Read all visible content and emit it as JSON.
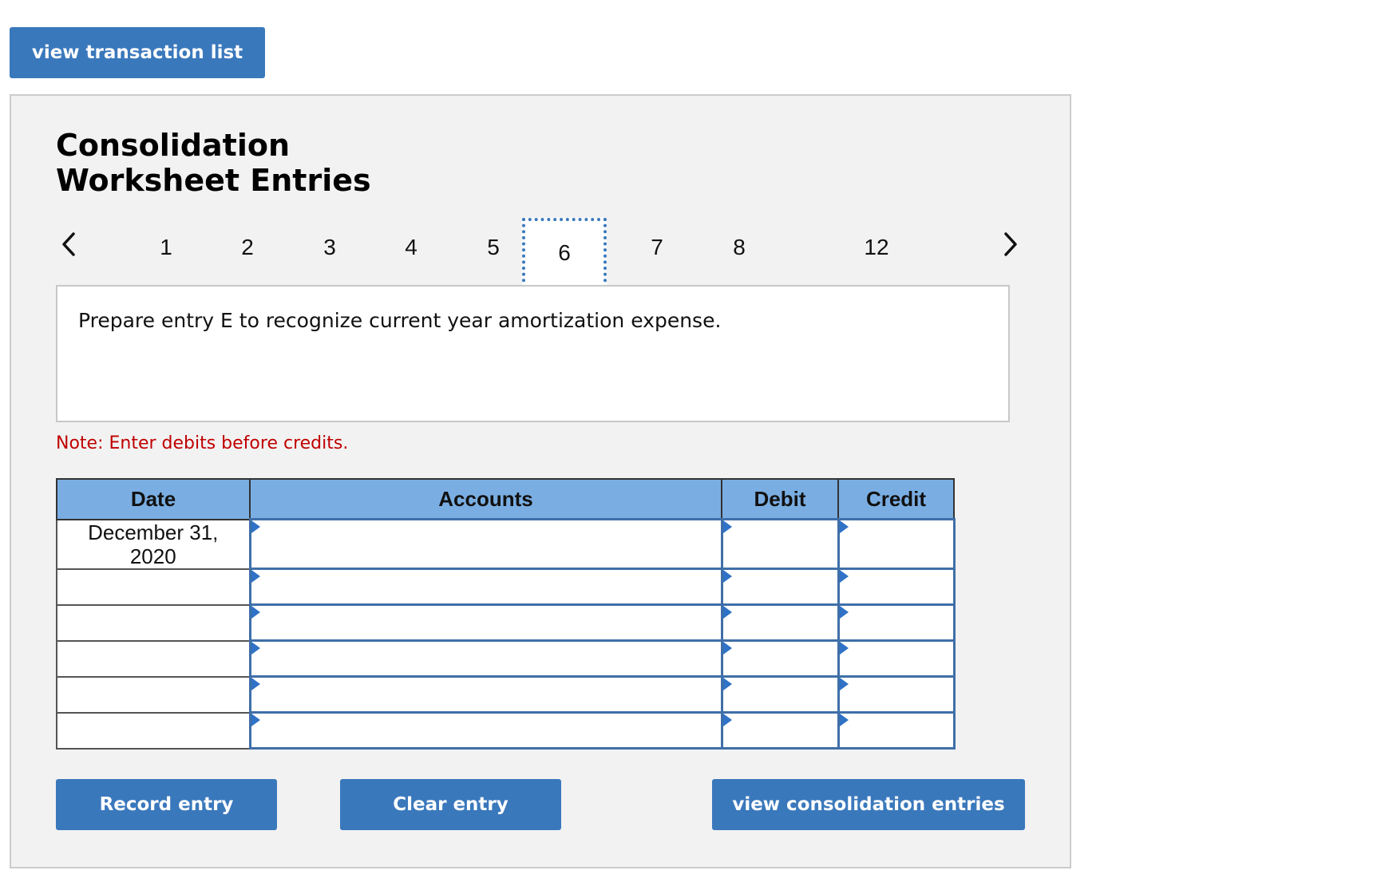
{
  "top_button": {
    "label": "view transaction list"
  },
  "title": {
    "line1": "Consolidation",
    "line2": "Worksheet Entries"
  },
  "pagination": {
    "prev_icon": "chevron-left-icon",
    "next_icon": "chevron-right-icon",
    "pages": [
      "1",
      "2",
      "3",
      "4",
      "5",
      "6",
      "7",
      "8",
      "12"
    ],
    "active": "6"
  },
  "prompt": {
    "text": "Prepare entry E to recognize current year amortization expense."
  },
  "note": {
    "text": "Note: Enter debits before credits."
  },
  "table": {
    "headers": {
      "date": "Date",
      "accounts": "Accounts",
      "debit": "Debit",
      "credit": "Credit"
    },
    "rows": [
      {
        "date_line1": "December 31,",
        "date_line2": "2020",
        "account": "",
        "debit": "",
        "credit": ""
      },
      {
        "date_line1": "",
        "date_line2": "",
        "account": "",
        "debit": "",
        "credit": ""
      },
      {
        "date_line1": "",
        "date_line2": "",
        "account": "",
        "debit": "",
        "credit": ""
      },
      {
        "date_line1": "",
        "date_line2": "",
        "account": "",
        "debit": "",
        "credit": ""
      },
      {
        "date_line1": "",
        "date_line2": "",
        "account": "",
        "debit": "",
        "credit": ""
      },
      {
        "date_line1": "",
        "date_line2": "",
        "account": "",
        "debit": "",
        "credit": ""
      }
    ]
  },
  "buttons": {
    "record": "Record entry",
    "clear": "Clear entry",
    "view_entries": "view consolidation entries"
  },
  "colors": {
    "button": "#3a78bc",
    "header": "#7aaee3",
    "note": "#c00000",
    "active_tab_border": "#3a78bc"
  }
}
